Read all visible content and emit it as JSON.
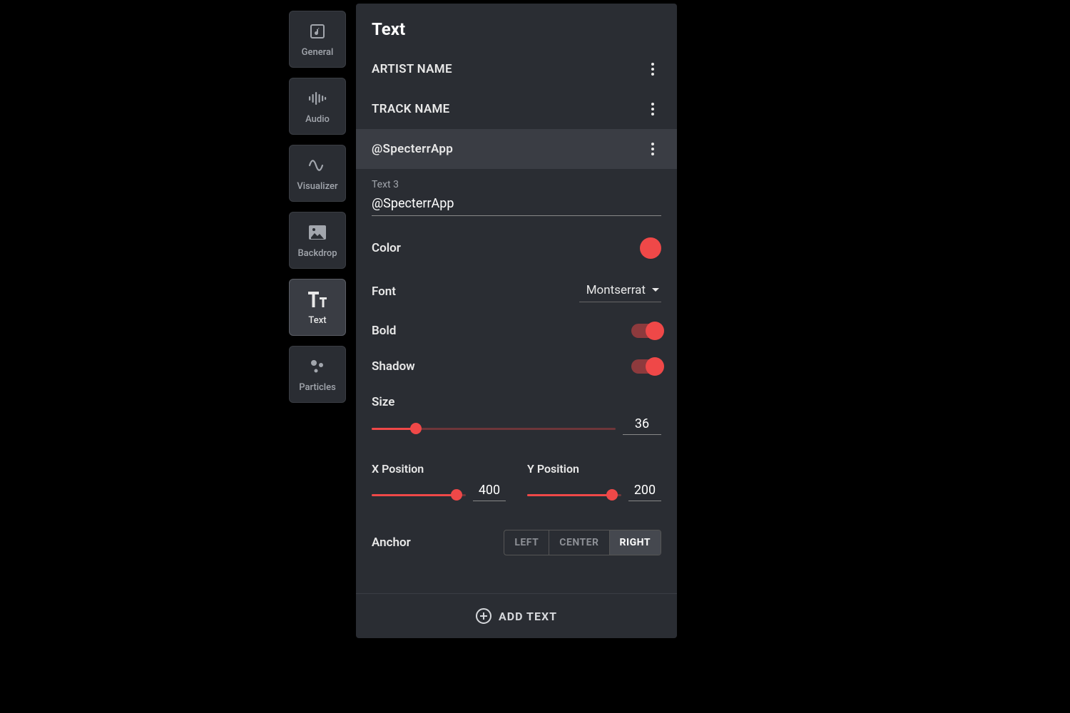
{
  "sidebar": {
    "items": [
      {
        "label": "General"
      },
      {
        "label": "Audio"
      },
      {
        "label": "Visualizer"
      },
      {
        "label": "Backdrop"
      },
      {
        "label": "Text"
      },
      {
        "label": "Particles"
      }
    ],
    "active_index": 4
  },
  "panel": {
    "title": "Text",
    "text_items": [
      {
        "name": "ARTIST NAME"
      },
      {
        "name": "TRACK NAME"
      },
      {
        "name": "@SpecterrApp"
      }
    ],
    "selected_index": 2,
    "editor": {
      "field_label": "Text 3",
      "value": "@SpecterrApp",
      "color_label": "Color",
      "color_hex": "#ef4848",
      "font_label": "Font",
      "font_value": "Montserrat",
      "bold_label": "Bold",
      "bold_on": true,
      "shadow_label": "Shadow",
      "shadow_on": true,
      "size_label": "Size",
      "size_value": "36",
      "size_percent": 18,
      "x_label": "X Position",
      "x_value": "400",
      "x_percent": 90,
      "y_label": "Y Position",
      "y_value": "200",
      "y_percent": 90,
      "anchor_label": "Anchor",
      "anchor_options": [
        "LEFT",
        "CENTER",
        "RIGHT"
      ],
      "anchor_selected": "RIGHT"
    },
    "add_text_label": "ADD TEXT"
  }
}
